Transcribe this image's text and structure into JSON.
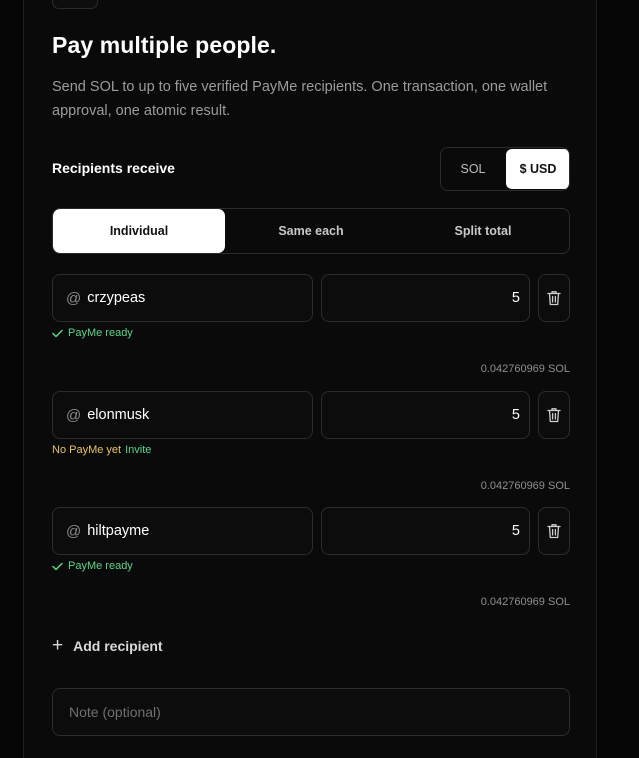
{
  "header": {
    "title": "Pay multiple people.",
    "subtitle": "Send SOL to up to five verified PayMe recipients. One transaction, one wallet approval, one atomic result."
  },
  "receive": {
    "label": "Recipients receive",
    "options": [
      "SOL",
      "$ USD"
    ],
    "selected": "$ USD"
  },
  "modes": {
    "tabs": [
      "Individual",
      "Same each",
      "Split total"
    ],
    "active": "Individual"
  },
  "recipients": [
    {
      "at": "@",
      "handle": "crzypeas",
      "amount": "5",
      "status": "PayMe ready",
      "status_type": "ready",
      "sol": "0.042760969 SOL"
    },
    {
      "at": "@",
      "handle": "elonmusk",
      "amount": "5",
      "status": "No PayMe yet",
      "invite": "Invite",
      "status_type": "missing",
      "sol": "0.042760969 SOL"
    },
    {
      "at": "@",
      "handle": "hiltpayme",
      "amount": "5",
      "status": "PayMe ready",
      "status_type": "ready",
      "sol": "0.042760969 SOL"
    }
  ],
  "add_recipient": {
    "icon": "+",
    "label": "Add recipient"
  },
  "note": {
    "placeholder": "Note (optional)",
    "value": ""
  },
  "colors": {
    "background": "#0a0a0a",
    "ready": "#5fd38a",
    "warning": "#e8c36b",
    "muted": "#9b9b9b"
  }
}
